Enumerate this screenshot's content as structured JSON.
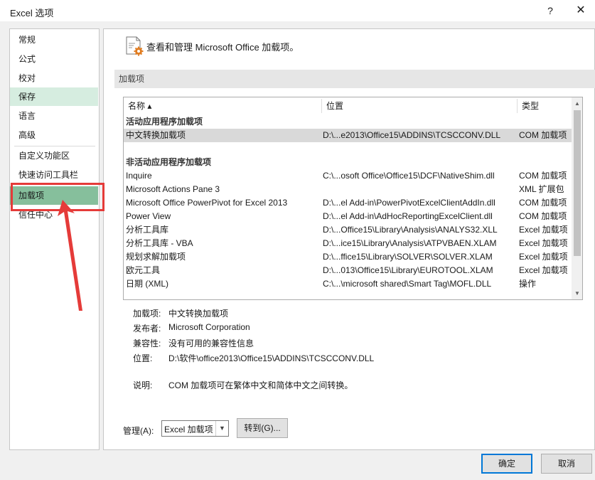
{
  "window": {
    "title": "Excel 选项",
    "help": "?",
    "close": "✕"
  },
  "sidebar": {
    "items": [
      {
        "label": "常规"
      },
      {
        "label": "公式"
      },
      {
        "label": "校对"
      },
      {
        "label": "保存"
      },
      {
        "label": "语言"
      },
      {
        "label": "高级"
      },
      {
        "label": "自定义功能区"
      },
      {
        "label": "快速访问工具栏"
      },
      {
        "label": "加载项"
      },
      {
        "label": "信任中心"
      }
    ],
    "active": "加载项"
  },
  "main": {
    "header": "查看和管理 Microsoft Office 加载项。",
    "section_title": "加载项",
    "columns": {
      "name": "名称 ▴",
      "location": "位置",
      "type": "类型"
    },
    "groups": [
      {
        "title": "活动应用程序加载项",
        "rows": [
          {
            "name": "中文转换加载项",
            "location": "D:\\...e2013\\Office15\\ADDINS\\TCSCCONV.DLL",
            "type": "COM 加载项"
          }
        ]
      },
      {
        "title": "非活动应用程序加载项",
        "rows": [
          {
            "name": "Inquire",
            "location": "C:\\...osoft Office\\Office15\\DCF\\NativeShim.dll",
            "type": "COM 加载项"
          },
          {
            "name": "Microsoft Actions Pane 3",
            "location": "",
            "type": "XML 扩展包"
          },
          {
            "name": "Microsoft Office PowerPivot for Excel 2013",
            "location": "D:\\...el Add-in\\PowerPivotExcelClientAddIn.dll",
            "type": "COM 加载项"
          },
          {
            "name": "Power View",
            "location": "D:\\...el Add-in\\AdHocReportingExcelClient.dll",
            "type": "COM 加载项"
          },
          {
            "name": "分析工具库",
            "location": "D:\\...Office15\\Library\\Analysis\\ANALYS32.XLL",
            "type": "Excel 加载项"
          },
          {
            "name": "分析工具库 - VBA",
            "location": "D:\\...ice15\\Library\\Analysis\\ATPVBAEN.XLAM",
            "type": "Excel 加载项"
          },
          {
            "name": "规划求解加载项",
            "location": "D:\\...ffice15\\Library\\SOLVER\\SOLVER.XLAM",
            "type": "Excel 加载项"
          },
          {
            "name": "欧元工具",
            "location": "D:\\...013\\Office15\\Library\\EUROTOOL.XLAM",
            "type": "Excel 加载项"
          },
          {
            "name": "日期 (XML)",
            "location": "C:\\...\\microsoft shared\\Smart Tag\\MOFL.DLL",
            "type": "操作"
          }
        ]
      }
    ],
    "details": {
      "addin_label": "加载项:",
      "addin_value": "中文转换加载项",
      "publisher_label": "发布者:",
      "publisher_value": "Microsoft Corporation",
      "compat_label": "兼容性:",
      "compat_value": "没有可用的兼容性信息",
      "location_label": "位置:",
      "location_value": "D:\\软件\\office2013\\Office15\\ADDINS\\TCSCCONV.DLL",
      "desc_label": "说明:",
      "desc_value": "COM 加载项可在繁体中文和简体中文之间转换。"
    },
    "manage": {
      "label": "管理(A):",
      "selected": "Excel 加载项",
      "go_button": "转到(G)..."
    }
  },
  "footer": {
    "ok": "确定",
    "cancel": "取消"
  },
  "colors": {
    "accent": "#86bf9c",
    "annotation": "#e53b39",
    "default_button_border": "#0078d7"
  },
  "icons": [
    "addin-settings-icon",
    "sort-ascending-icon",
    "scroll-up-icon",
    "scroll-down-icon",
    "dropdown-arrow-icon",
    "close-icon"
  ]
}
